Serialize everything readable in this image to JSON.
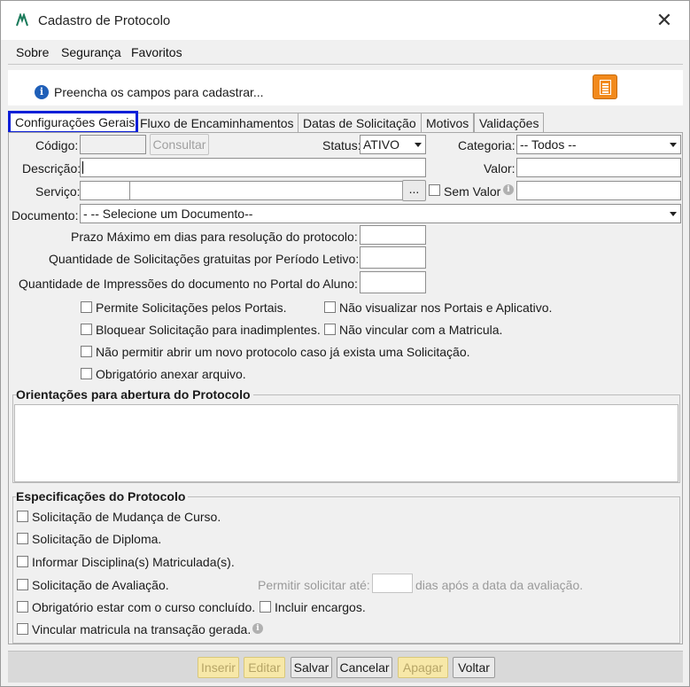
{
  "window": {
    "title": "Cadastro de Protocolo",
    "close": "✕"
  },
  "menu": [
    "Sobre",
    "Segurança",
    "Favoritos"
  ],
  "info": {
    "icon": "info-icon",
    "text": "Preencha os campos para cadastrar..."
  },
  "tabs": [
    "Configurações Gerais",
    "Fluxo de Encaminhamentos",
    "Datas de Solicitação",
    "Motivos",
    "Validações"
  ],
  "form": {
    "codigo_label": "Código:",
    "consultar": "Consultar",
    "status_label": "Status:",
    "status_value": "ATIVO",
    "categoria_label": "Categoria:",
    "categoria_value": "-- Todos --",
    "descricao_label": "Descrição:",
    "valor_label": "Valor:",
    "servico_label": "Serviço:",
    "servico_btn": "...",
    "sem_valor": "Sem Valor",
    "documento_label": "Documento:",
    "documento_value": "- -- Selecione um Documento--",
    "prazo_label": "Prazo Máximo em dias para resolução do protocolo:",
    "gratuitas_label": "Quantidade de Solicitações gratuitas por Período Letivo:",
    "impressoes_label": "Quantidade de Impressões do documento no Portal do Aluno:"
  },
  "checks": {
    "portais": "Permite Solicitações pelos Portais.",
    "nao_visualizar": "Não visualizar nos Portais e Aplicativo.",
    "bloquear": "Bloquear Solicitação para inadimplentes.",
    "nao_vincular": "Não vincular com a Matricula.",
    "nao_permitir": "Não permitir abrir um novo protocolo caso já exista uma Solicitação.",
    "obrigatorio_anexar": "Obrigatório anexar arquivo."
  },
  "orientacoes_title": "Orientações para abertura do Protocolo",
  "especificacoes": {
    "title": "Especificações do Protocolo",
    "mudanca": "Solicitação de Mudança de Curso.",
    "diploma": "Solicitação de Diploma.",
    "disciplinas": "Informar Disciplina(s) Matriculada(s).",
    "avaliacao": "Solicitação de Avaliação.",
    "permitir_ate": "Permitir solicitar até:",
    "dias_apos": "dias após a data da avaliação.",
    "concluido": "Obrigatório estar com o curso concluído.",
    "encargos": "Incluir encargos.",
    "vincular": "Vincular matricula na transação gerada."
  },
  "footer": {
    "inserir": "Inserir",
    "editar": "Editar",
    "salvar": "Salvar",
    "cancelar": "Cancelar",
    "apagar": "Apagar",
    "voltar": "Voltar"
  },
  "colors": {
    "active_tab_border": "#0b1fd8",
    "doc_button": "#f28a1c",
    "info_icon": "#1f5fb8"
  }
}
